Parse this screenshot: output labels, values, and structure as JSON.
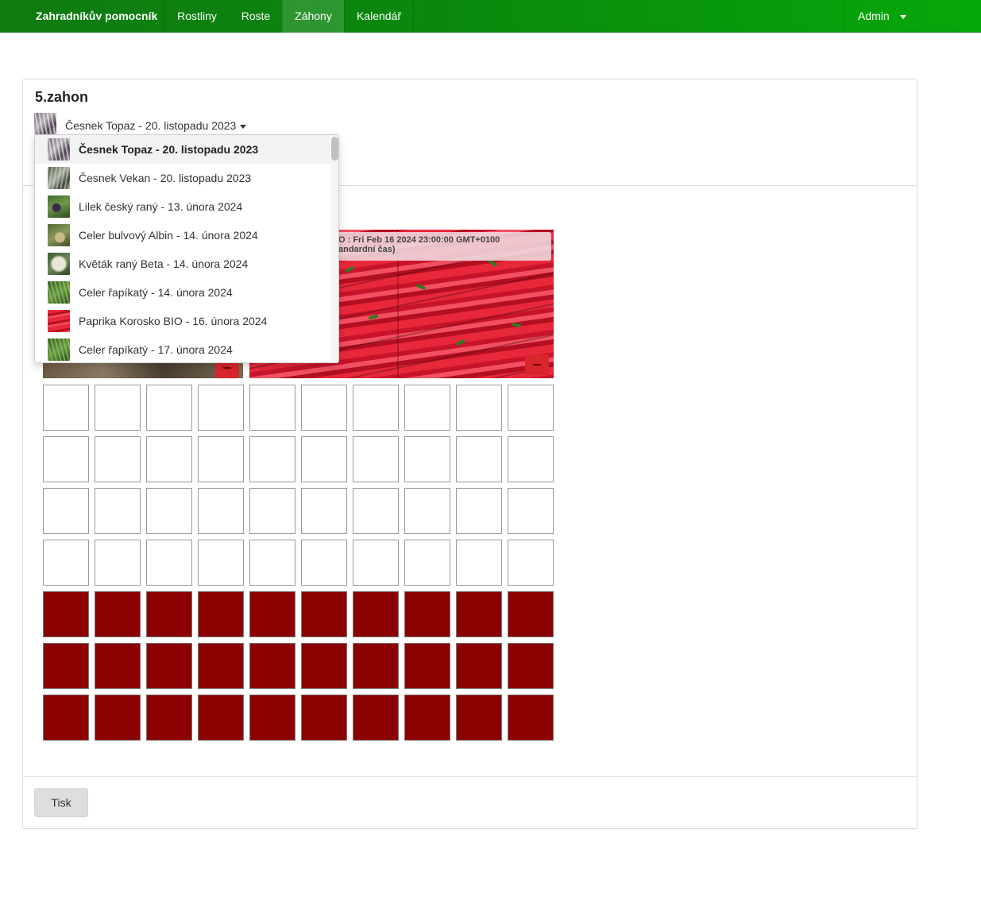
{
  "navbar": {
    "brand": "Zahradníkův pomocník",
    "items": [
      {
        "label": "Rostliny",
        "active": false
      },
      {
        "label": "Roste",
        "active": false
      },
      {
        "label": "Záhony",
        "active": true
      },
      {
        "label": "Kalendář",
        "active": false
      }
    ],
    "user": "Admin"
  },
  "bed": {
    "title": "5.zahon",
    "select": {
      "value": "Česnek Topaz - 20. listopadu 2023",
      "thumb_icon": "garlic-thumbnail"
    },
    "dropdown_options": [
      {
        "label": "Česnek Topaz - 20. listopadu 2023",
        "icon": "garlic-thumbnail",
        "selected": true
      },
      {
        "label": "Česnek Vekan - 20. listopadu 2023",
        "icon": "garlic-thumbnail",
        "selected": false
      },
      {
        "label": "Lilek český raný - 13. února 2024",
        "icon": "eggplant-thumbnail",
        "selected": false
      },
      {
        "label": "Celer bulvový Albin - 14. února 2024",
        "icon": "celery-root-thumbnail",
        "selected": false
      },
      {
        "label": "Květák raný Beta - 14. února 2024",
        "icon": "cauliflower-thumbnail",
        "selected": false
      },
      {
        "label": "Celer řapíkatý - 14. února 2024",
        "icon": "celery-thumbnail",
        "selected": false
      },
      {
        "label": "Paprika Korosko BIO - 16. února 2024",
        "icon": "pepper-thumbnail",
        "selected": false
      },
      {
        "label": "Celer řapíkatý - 17. února 2024",
        "icon": "celery-thumbnail",
        "selected": false
      }
    ],
    "planting_tooltip": {
      "line1": "O : Fri Feb 16 2024 23:00:00 GMT+0100",
      "line2": "andardní čas)"
    },
    "grid": {
      "columns": 10,
      "empty_rows": 4,
      "filled_rows": 3,
      "filled_color": "#8b0000"
    },
    "print_button": "Tisk"
  },
  "colors": {
    "navbar": "#0a8a0c",
    "planted_cell": "#8b0000",
    "remove_button": "#d9262c"
  }
}
